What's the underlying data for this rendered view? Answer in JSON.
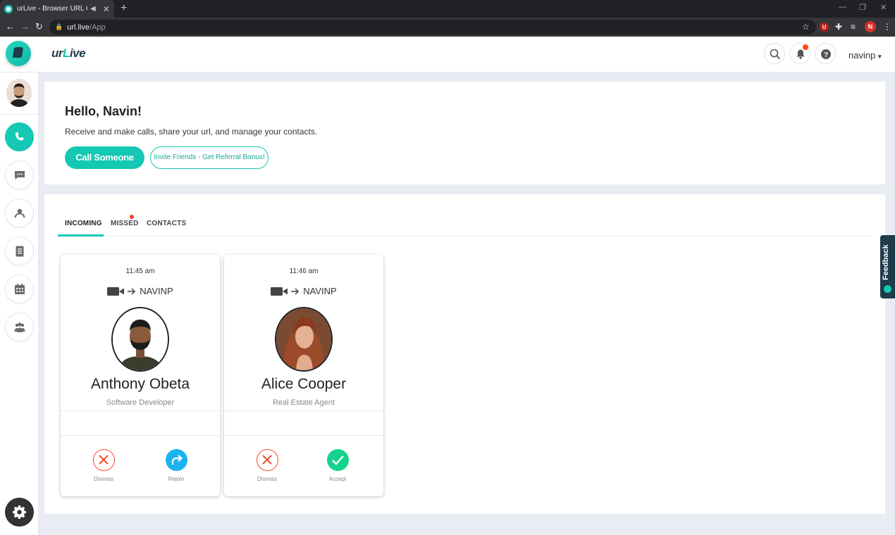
{
  "browser": {
    "tab_title": "urLive - Browser URL Calling",
    "url_host": "url.live",
    "url_path": "/App",
    "profile_initial": "N",
    "extension_badge": "U"
  },
  "header": {
    "brand_prefix": "ur",
    "brand_l": "L",
    "brand_suffix": "ive",
    "username": "navinp"
  },
  "welcome": {
    "greeting": "Hello, Navin!",
    "subtitle": "Receive and make calls, share your url, and manage your contacts.",
    "call_button": "Call Someone",
    "invite_button": "Invite Friends - Get Referral Bonus!"
  },
  "tabs": [
    {
      "label": "INCOMING"
    },
    {
      "label": "MISSED"
    },
    {
      "label": "CONTACTS"
    }
  ],
  "cards": [
    {
      "time": "11:45 am",
      "route": "NAVINP",
      "name": "Anthony Obeta",
      "role": "Software Developer",
      "left_action": "Dismiss",
      "right_action": "Rejoin"
    },
    {
      "time": "11:46 am",
      "route": "NAVINP",
      "name": "Alice Cooper",
      "role": "Real Estate Agent",
      "left_action": "Dismiss",
      "right_action": "Accept"
    }
  ],
  "feedback_label": "Feedback",
  "colors": {
    "accent": "#14c8b3",
    "dismiss": "#f04e23",
    "rejoin": "#1ab3f0",
    "accept": "#15d28d",
    "notification": "#ff4b1f"
  },
  "icons": {
    "sidebar": [
      "phone-icon",
      "chat-icon",
      "contact-icon",
      "document-icon",
      "calendar-icon",
      "group-icon",
      "settings-icon"
    ],
    "header": [
      "search-icon",
      "bell-icon",
      "help-icon"
    ]
  }
}
